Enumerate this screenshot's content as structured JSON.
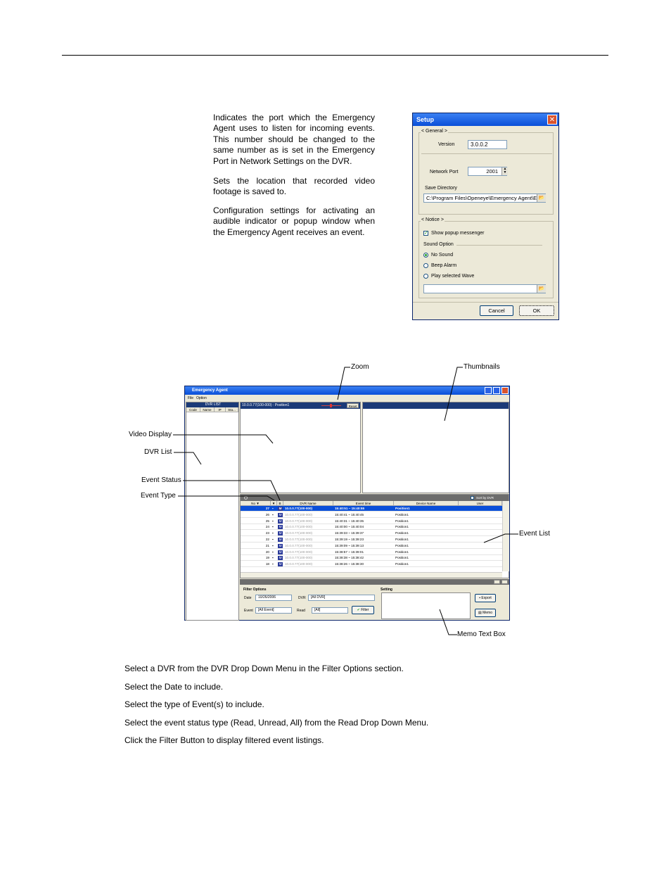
{
  "paragraphs": [
    "Indicates the port which the Emergency Agent uses to listen for incoming events. This number should be changed to the same number as is set in the Emergency Port in Network Settings on the DVR.",
    "Sets the location that recorded video footage is saved to.",
    "Configuration settings for activating an audible indicator or popup window when the Emergency Agent receives an event."
  ],
  "setup": {
    "title": "Setup",
    "close": "✕",
    "general_label": "< General >",
    "version_label": "Version",
    "version_value": "3.0.0.2",
    "port_label": "Network Port",
    "port_value": "2001",
    "save_dir_label": "Save Directory",
    "save_dir_value": "C:\\Program Files\\Openeye\\Emergency Agent\\E/",
    "notice_label": "< Notice >",
    "popup_label": "Show popup messenger",
    "sound_option_label": "Sound Option",
    "no_sound": "No Sound",
    "beep_alarm": "Beep Alarm",
    "play_wave": "Play selected Wave",
    "cancel": "Cancel",
    "ok": "OK"
  },
  "annotations": {
    "zoom": "Zoom",
    "thumbnails": "Thumbnails",
    "video_display": "Video Display",
    "dvr_list": "DVR List",
    "event_status": "Event Status",
    "event_type": "Event Type",
    "event_list": "Event List",
    "memo": "Memo Text Box"
  },
  "agent": {
    "title": "Emergency Agent",
    "menu": [
      "File",
      "Option"
    ],
    "dvr_list_title": "DVR LIST",
    "dvr_cols": [
      "Code",
      "Name",
      "IP",
      "Sta..."
    ],
    "video_bar": "10.0.0.77(100-000) : Position1",
    "reset": "Reset",
    "sort_label": "Sort by DVR",
    "event_cols": [
      "No ▼",
      "▼",
      "B",
      "DVR Name",
      "Event time",
      "Device Name",
      "User"
    ],
    "events": [
      {
        "no": "27",
        "dvr": "10.0.0.77(100-000)",
        "time": "15:40:51  ~  15:40:55",
        "device": "Position1"
      },
      {
        "no": "26",
        "dvr": "10.0.0.77(100-000)",
        "time": "15:40:41  ~  15:40:45",
        "device": "Position1"
      },
      {
        "no": "25",
        "dvr": "10.0.0.77(100-000)",
        "time": "15:40:31  ~  15:40:35",
        "device": "Position1"
      },
      {
        "no": "24",
        "dvr": "10.0.0.77(100-000)",
        "time": "15:40:00  ~  15:40:04",
        "device": "Position1"
      },
      {
        "no": "23",
        "dvr": "10.0.0.77(100-000)",
        "time": "15:39:33  ~  15:39:37",
        "device": "Position1"
      },
      {
        "no": "22",
        "dvr": "10.0.0.77(100-000)",
        "time": "15:39:19  ~  15:39:23",
        "device": "Position1"
      },
      {
        "no": "21",
        "dvr": "10.0.0.77(100-000)",
        "time": "15:39:09  ~  15:39:13",
        "device": "Position1"
      },
      {
        "no": "20",
        "dvr": "10.0.0.77(100-000)",
        "time": "15:38:57  ~  15:39:01",
        "device": "Position1"
      },
      {
        "no": "19",
        "dvr": "10.0.0.77(100-000)",
        "time": "15:38:38  ~  15:38:42",
        "device": "Position1"
      },
      {
        "no": "18",
        "dvr": "10.0.0.77(100-000)",
        "time": "15:38:26  ~  15:38:30",
        "device": "Position1"
      }
    ],
    "filter_title": "Filter Options",
    "date_label": "Date",
    "date_value": "10/26/2006",
    "dvr_label": "DVR",
    "dvr_value": "[All DVR]",
    "event_label": "Event",
    "event_value": "[All Event]",
    "read_label": "Read",
    "read_value": "[All]",
    "filter_btn": "Filter",
    "setting_title": "Setting",
    "export_btn": "Export",
    "memo_btn": "Memo"
  },
  "steps": [
    "Select a DVR from the DVR Drop Down Menu in the Filter Options section.",
    "Select the Date to include.",
    "Select the type of Event(s) to include.",
    "Select the event status type (Read, Unread, All) from the Read Drop Down Menu.",
    "Click the Filter Button to display filtered event listings."
  ]
}
